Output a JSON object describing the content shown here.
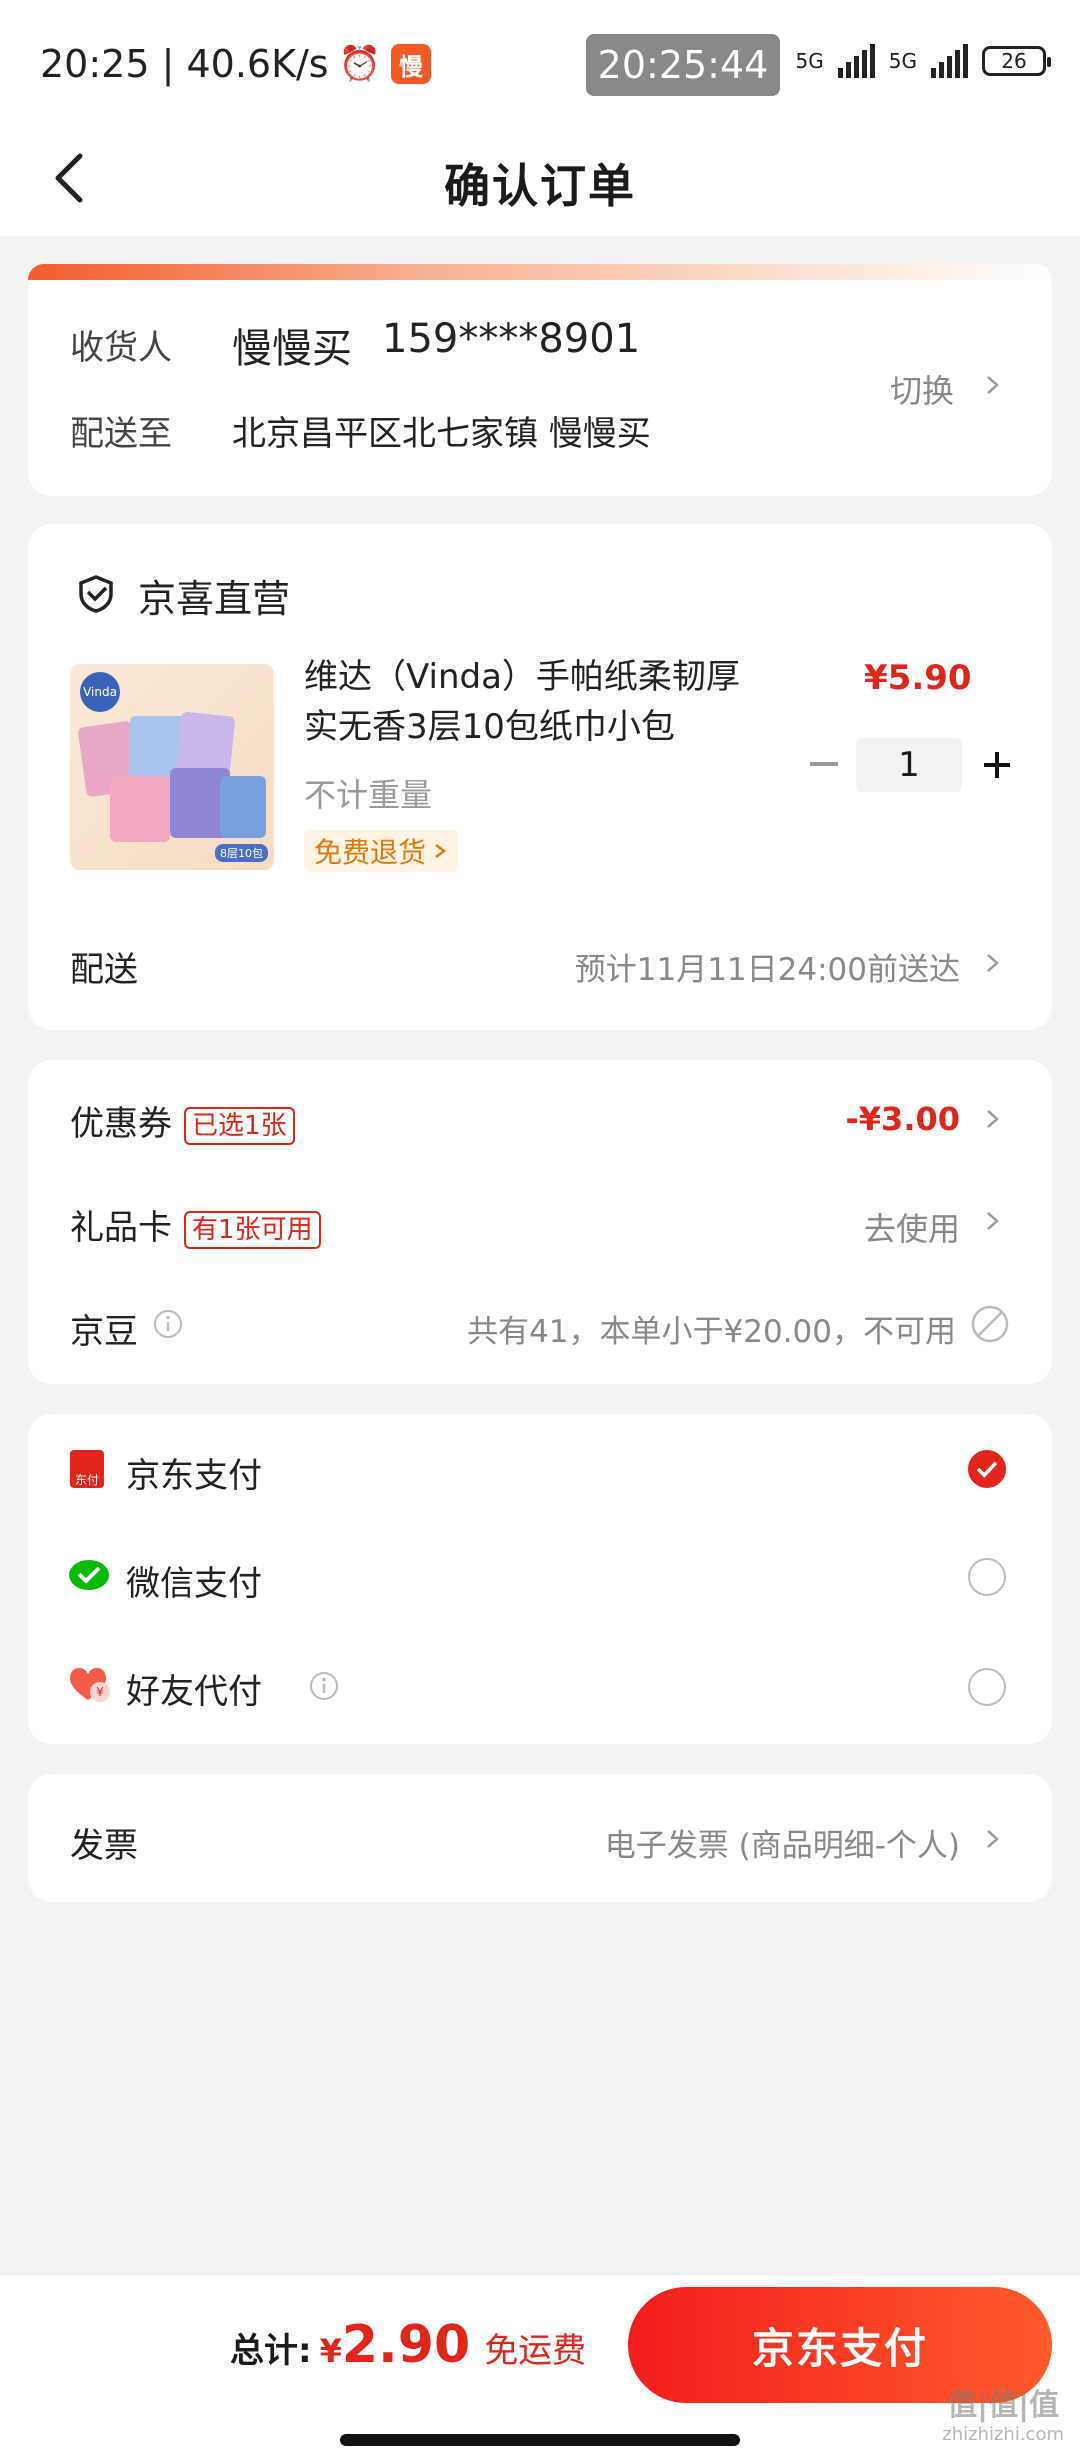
{
  "status_bar": {
    "time_speed": "20:25 | 40.6K/s",
    "app_badge": "慢",
    "overlay_time": "20:25:44",
    "net1": "5G",
    "net2": "5G",
    "battery": "26"
  },
  "nav": {
    "title": "确认订单"
  },
  "address": {
    "receiver_label": "收货人",
    "receiver_name": "慢慢买",
    "receiver_phone": "159****8901",
    "ship_to_label": "配送至",
    "ship_to_value": "北京昌平区北七家镇 慢慢买",
    "switch_label": "切换"
  },
  "store": {
    "name": "京喜直营",
    "product": {
      "title_line1": "维达（Vinda）手帕纸柔韧厚",
      "title_line2": "实无香3层10包纸巾小包",
      "price": "¥5.90",
      "weight": "不计重量",
      "return_badge": "免费退货",
      "quantity": "1",
      "image_brand": "Vinda",
      "image_tag": "8层10包"
    },
    "delivery_label": "配送",
    "delivery_value": "预计11月11日24:00前送达"
  },
  "discounts": {
    "coupon_label": "优惠券",
    "coupon_badge": "已选1张",
    "coupon_value": "-¥3.00",
    "giftcard_label": "礼品卡",
    "giftcard_badge": "有1张可用",
    "giftcard_value": "去使用",
    "jingdou_label": "京豆",
    "jingdou_value": "共有41，本单小于¥20.00，不可用"
  },
  "payment": {
    "options": [
      {
        "label": "京东支付",
        "icon_text": "东付",
        "selected": true
      },
      {
        "label": "微信支付",
        "selected": false
      },
      {
        "label": "好友代付",
        "selected": false
      }
    ]
  },
  "invoice": {
    "label": "发票",
    "value": "电子发票 (商品明细-个人)"
  },
  "bottom": {
    "total_label": "总计:",
    "total_currency": "¥",
    "total_amount": "2.90",
    "free_shipping": "免运费",
    "pay_button": "京东支付"
  },
  "watermark": {
    "main": "值|值|值",
    "sub": "zhizhizhi.com"
  },
  "colors": {
    "accent": "#e1251b",
    "orange": "#f15a24",
    "wechat": "#09bb07"
  }
}
